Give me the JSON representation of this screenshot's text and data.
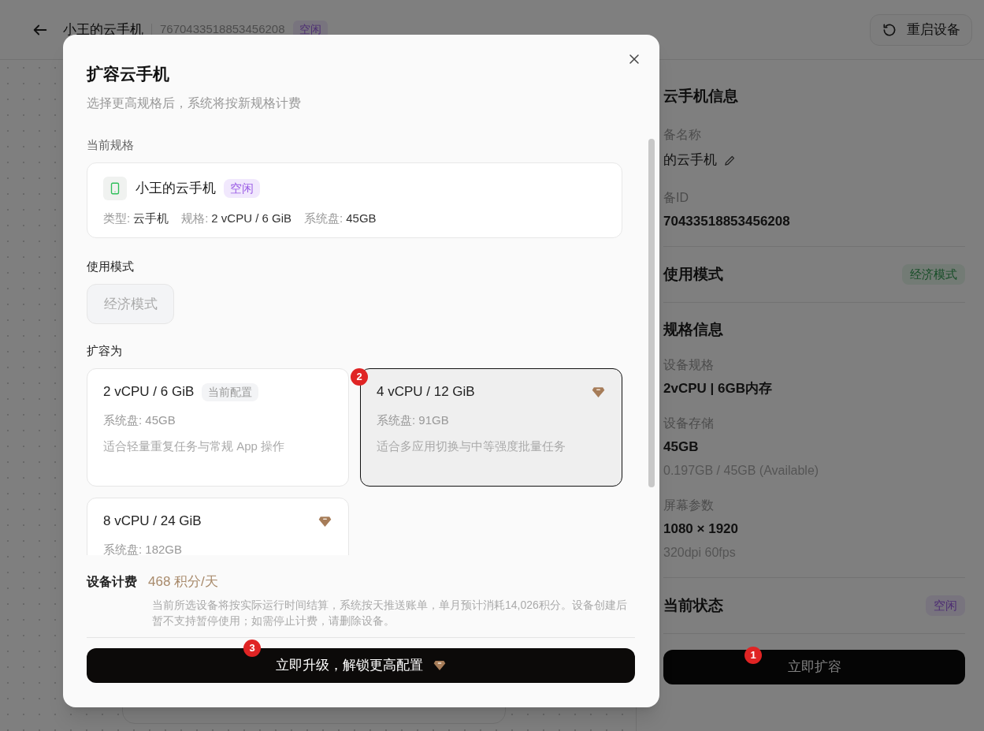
{
  "page": {
    "device_name": "小王的云手机",
    "device_id": "7670433518853456208",
    "status": "空闲",
    "restart_button": "重启设备",
    "info": {
      "title": "云手机信息",
      "name_label": "备名称",
      "name_value": "的云手机",
      "id_label": "备ID",
      "id_value": "70433518853456208"
    },
    "mode": {
      "title": "使用模式",
      "badge": "经济模式"
    },
    "spec": {
      "title": "规格信息",
      "fields": [
        {
          "label": "设备规格",
          "value": "2vCPU | 6GB内存"
        },
        {
          "label": "设备存储",
          "value": "45GB",
          "note": "0.197GB / 45GB (Available)"
        },
        {
          "label": "屏幕参数",
          "value": "1080 × 1920",
          "note": "320dpi 60fps"
        }
      ]
    },
    "state": {
      "title": "当前状态",
      "badge": "空闲"
    },
    "expand_button": "立即扩容",
    "expand_marker": "1"
  },
  "dialog": {
    "title": "扩容云手机",
    "subtitle": "选择更高规格后，系统将按新规格计费",
    "current_label": "当前规格",
    "current": {
      "name": "小王的云手机",
      "status": "空闲",
      "meta": [
        {
          "label": "类型:",
          "value": "云手机"
        },
        {
          "label": "规格:",
          "value": "2 vCPU / 6 GiB"
        },
        {
          "label": "系统盘:",
          "value": "45GB"
        }
      ]
    },
    "mode_label": "使用模式",
    "mode_option": {
      "label": "经济模式",
      "disabled": true
    },
    "expand_label": "扩容为",
    "options": [
      {
        "title": "2 vCPU / 6 GiB",
        "tag": "当前配置",
        "disk": "系统盘: 45GB",
        "desc": "适合轻量重复任务与常规 App 操作",
        "premium": false,
        "selected": false
      },
      {
        "title": "4 vCPU / 12 GiB",
        "disk": "系统盘: 91GB",
        "desc": "适合多应用切换与中等强度批量任务",
        "premium": true,
        "selected": true,
        "marker": "2"
      },
      {
        "title": "8 vCPU / 24 GiB",
        "disk": "系统盘: 182GB",
        "premium": true,
        "selected": false
      }
    ],
    "billing": {
      "label": "设备计费",
      "price": "468 积分/天",
      "note": "当前所选设备将按实际运行时间结算，系统按天推送账单，单月预计消耗14,026积分。设备创建后暂不支持暂停使用；如需停止计费，请删除设备。"
    },
    "upgrade_button": "立即升级，解锁更高配置",
    "upgrade_marker": "3"
  }
}
